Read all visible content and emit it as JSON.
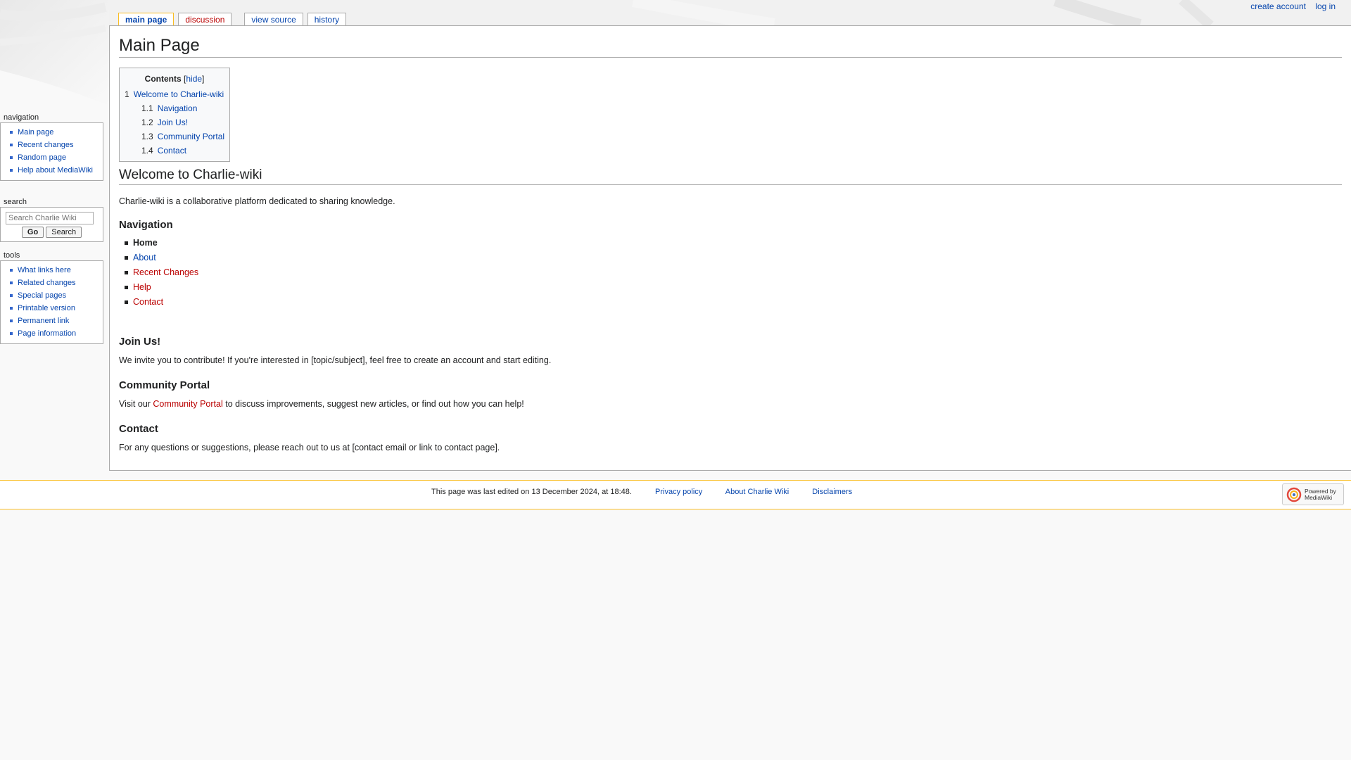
{
  "personal": {
    "create_account": "create account",
    "log_in": "log in"
  },
  "tabs": [
    {
      "label": "main page"
    },
    {
      "label": "discussion"
    },
    {
      "label": "view source"
    },
    {
      "label": "history"
    }
  ],
  "sidebar": {
    "navigation": {
      "title": "navigation",
      "items": [
        "Main page",
        "Recent changes",
        "Random page",
        "Help about MediaWiki"
      ]
    },
    "search": {
      "title": "search",
      "placeholder": "Search Charlie Wiki",
      "go": "Go",
      "search": "Search"
    },
    "tools": {
      "title": "tools",
      "items": [
        "What links here",
        "Related changes",
        "Special pages",
        "Printable version",
        "Permanent link",
        "Page information"
      ]
    }
  },
  "content": {
    "title": "Main Page",
    "toc": {
      "title": "Contents",
      "hide": "hide",
      "items": [
        {
          "num": "1",
          "label": "Welcome to Charlie-wiki"
        },
        {
          "num": "1.1",
          "label": "Navigation"
        },
        {
          "num": "1.2",
          "label": "Join Us!"
        },
        {
          "num": "1.3",
          "label": "Community Portal"
        },
        {
          "num": "1.4",
          "label": "Contact"
        }
      ]
    },
    "welcome": {
      "heading": "Welcome to Charlie-wiki",
      "text": "Charlie-wiki is a collaborative platform dedicated to sharing knowledge."
    },
    "navigation": {
      "heading": "Navigation",
      "items": [
        {
          "label": "Home"
        },
        {
          "label": "About"
        },
        {
          "label": "Recent Changes"
        },
        {
          "label": "Help"
        },
        {
          "label": "Contact"
        }
      ]
    },
    "join": {
      "heading": "Join Us!",
      "text": "We invite you to contribute! If you're interested in [topic/subject], feel free to create an account and start editing."
    },
    "portal": {
      "heading": "Community Portal",
      "pre": "Visit our ",
      "link": "Community Portal",
      "post": " to discuss improvements, suggest new articles, or find out how you can help!"
    },
    "contact": {
      "heading": "Contact",
      "text": "For any questions or suggestions, please reach out to us at [contact email or link to contact page]."
    }
  },
  "footer": {
    "last_edited": "This page was last edited on 13 December 2024, at 18:48.",
    "privacy": "Privacy policy",
    "about": "About Charlie Wiki",
    "disclaimers": "Disclaimers",
    "powered_line1": "Powered by",
    "powered_line2": "MediaWiki"
  },
  "colors": {
    "link": "#0645ad",
    "new_link": "#ba0000",
    "tab_selected_border": "#fabd23"
  }
}
